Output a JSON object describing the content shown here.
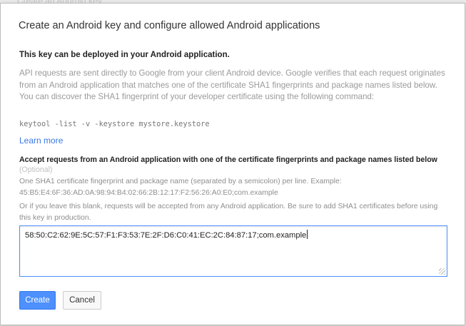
{
  "backdrop": {
    "text": "Create an Android key"
  },
  "dialog": {
    "title": "Create an Android key and configure allowed Android applications",
    "subtitle": "This key can be deployed in your Android application.",
    "description": "API requests are sent directly to Google from your client Android device. Google verifies that each request originates from an Android application that matches one of the certificate SHA1 fingerprints and package names listed below. You can discover the SHA1 fingerprint of your developer certificate using the following command:",
    "command": "keytool -list -v -keystore mystore.keystore",
    "learn_more": "Learn more",
    "field_label": "Accept requests from an Android application with one of the certificate fingerprints and package names listed below",
    "optional": "(Optional)",
    "help_line1": "One SHA1 certificate fingerprint and package name (separated by a semicolon) per line. Example:",
    "help_example": "45:B5:E4:6F:36:AD:0A:98:94:B4:02:66:2B:12:17:F2:56:26:A0:E0;com.example",
    "help_line2": "Or if you leave this blank, requests will be accepted from any Android application. Be sure to add SHA1 certificates before using this key in production.",
    "textarea_value": "58:50:C2:62:9E:5C:57:F1:F3:53:7E:2F:D6:C0:41:EC:2C:84:87:17;com.example",
    "create_button": "Create",
    "cancel_button": "Cancel"
  },
  "colors": {
    "primary": "#4d90fe",
    "link": "#3b78e7"
  }
}
